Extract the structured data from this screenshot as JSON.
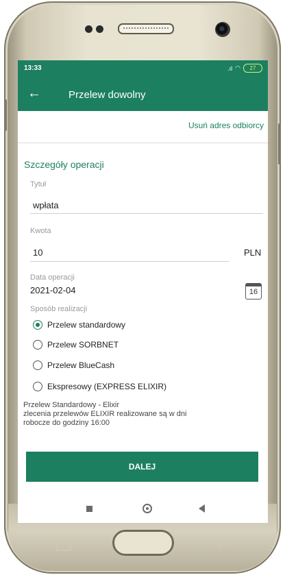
{
  "status_bar": {
    "time": "13:33",
    "signal": ".ıl",
    "wifi": "◠",
    "battery": "27"
  },
  "app_bar": {
    "title": "Przelew dowolny"
  },
  "recipient": {
    "remove_link": "Usuń adres odbiorcy"
  },
  "details": {
    "section_title": "Szczegóły operacji",
    "title_label": "Tytuł",
    "title_value": "wpłata",
    "amount_label": "Kwota",
    "amount_value": "10",
    "currency": "PLN",
    "date_label": "Data operacji",
    "date_value": "2021-02-04",
    "calendar_day": "16",
    "method_label": "Sposób realizacji",
    "methods": [
      {
        "label": "Przelew standardowy",
        "selected": true
      },
      {
        "label": "Przelew SORBNET",
        "selected": false
      },
      {
        "label": "Przelew BlueCash",
        "selected": false
      },
      {
        "label": "Ekspresowy (EXPRESS ELIXIR)",
        "selected": false
      }
    ],
    "info_line1": "Przelew Standardowy - Elixir",
    "info_line2": "zlecenia przelewów ELIXIR realizowane są w dni",
    "info_line3": "robocze do godziny 16:00"
  },
  "actions": {
    "next_label": "DALEJ"
  },
  "colors": {
    "primary": "#1c7f60",
    "battery": "#d9f36a"
  }
}
